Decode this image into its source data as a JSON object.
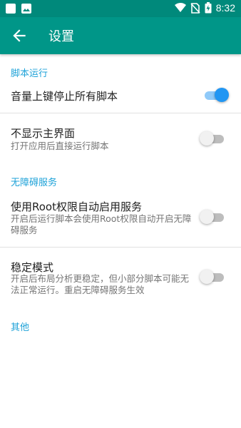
{
  "status_bar": {
    "time": "8:32",
    "left_icons": [
      "square-icon",
      "image-icon"
    ],
    "right_icons": [
      "wifi-icon",
      "no-sim-icon",
      "battery-charging-icon"
    ]
  },
  "app_bar": {
    "title": "设置",
    "back_icon": "arrow-back-icon"
  },
  "colors": {
    "app_bar": "#009688",
    "status_bar": "#00897b",
    "section_header": "#1ea2d8",
    "switch_on": "#2196f3"
  },
  "sections": [
    {
      "header": "脚本运行",
      "items": [
        {
          "title": "音量上键停止所有脚本",
          "subtitle": "",
          "switch_on": true
        },
        {
          "title": "不显示主界面",
          "subtitle": "打开应用后直接运行脚本",
          "switch_on": false
        }
      ]
    },
    {
      "header": "无障碍服务",
      "items": [
        {
          "title": "使用Root权限自动启用服务",
          "subtitle": "开启后运行脚本会使用Root权限自动开启无障碍服务",
          "switch_on": false
        },
        {
          "title": "稳定模式",
          "subtitle": "开启后布局分析更稳定，但小部分脚本可能无法正常运行。重启无障碍服务生效",
          "switch_on": false
        }
      ]
    },
    {
      "header": "其他",
      "items": []
    }
  ]
}
